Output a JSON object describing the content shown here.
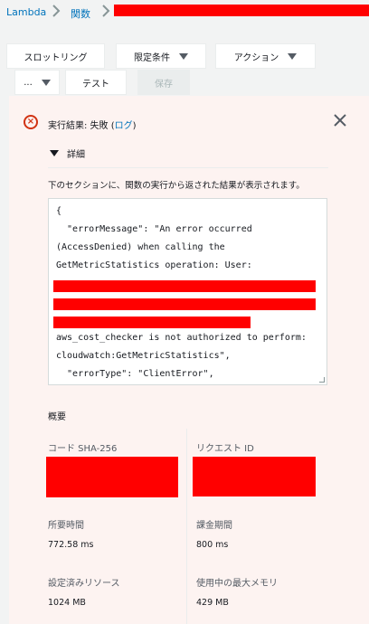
{
  "breadcrumb": {
    "home": "Lambda",
    "functions": "関数"
  },
  "toolbar": {
    "throttle": "スロットリング",
    "qualifiers": "限定条件",
    "actions": "アクション",
    "more": "...",
    "test": "テスト",
    "save": "保存"
  },
  "result": {
    "title_prefix": "実行結果: 失敗 (",
    "log_link": "ログ",
    "title_suffix": ")",
    "details_label": "詳細",
    "description": "下のセクションに、関数の実行から返された結果が表示されます。",
    "code_lines": [
      "{",
      "  \"errorMessage\": \"An error occurred",
      "(AccessDenied) when calling the",
      "GetMetricStatistics operation: User:",
      "aws_cost_checker is not authorized to perform:",
      "cloudwatch:GetMetricStatistics\",",
      "  \"errorType\": \"ClientError\","
    ]
  },
  "summary": {
    "heading": "概要",
    "code_sha_label": "コード SHA-256",
    "request_id_label": "リクエスト ID",
    "duration_label": "所要時間",
    "duration_value": "772.58 ms",
    "billed_label": "課金期間",
    "billed_value": "800 ms",
    "resources_label": "設定済みリソース",
    "resources_value": "1024 MB",
    "max_memory_label": "使用中の最大メモリ",
    "max_memory_value": "429 MB"
  },
  "colors": {
    "link": "#0073bb",
    "error": "#d13212",
    "redaction": "#ff0000",
    "panel_bg": "#fdf3f1"
  }
}
